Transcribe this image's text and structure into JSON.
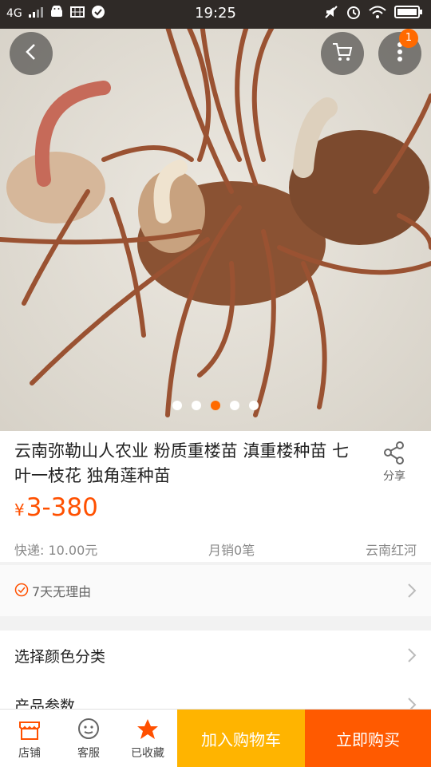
{
  "status_bar": {
    "network": "4G",
    "time": "19:25"
  },
  "top_nav": {
    "cart_badge": "1"
  },
  "carousel": {
    "pages": 5,
    "active_index": 2
  },
  "product": {
    "title": "云南弥勒山人农业 粉质重楼苗 滇重楼种苗 七叶一枝花 独角莲种苗",
    "share_label": "分享",
    "price_symbol": "¥",
    "price_range": "3-380",
    "shipping": "快递: 10.00元",
    "monthly_sales": "月销0笔",
    "location": "云南红河"
  },
  "guarantee": {
    "text": "7天无理由"
  },
  "options": {
    "select_label": "选择颜色分类",
    "params_label": "产品参数"
  },
  "bottom_bar": {
    "store_label": "店铺",
    "service_label": "客服",
    "favorite_label": "已收藏",
    "add_to_cart": "加入购物车",
    "buy_now": "立即购买"
  },
  "colors": {
    "accent": "#ff5000",
    "cart_button": "#ffb400",
    "buy_button": "#ff5a00",
    "status_bar": "#2f2a27"
  }
}
